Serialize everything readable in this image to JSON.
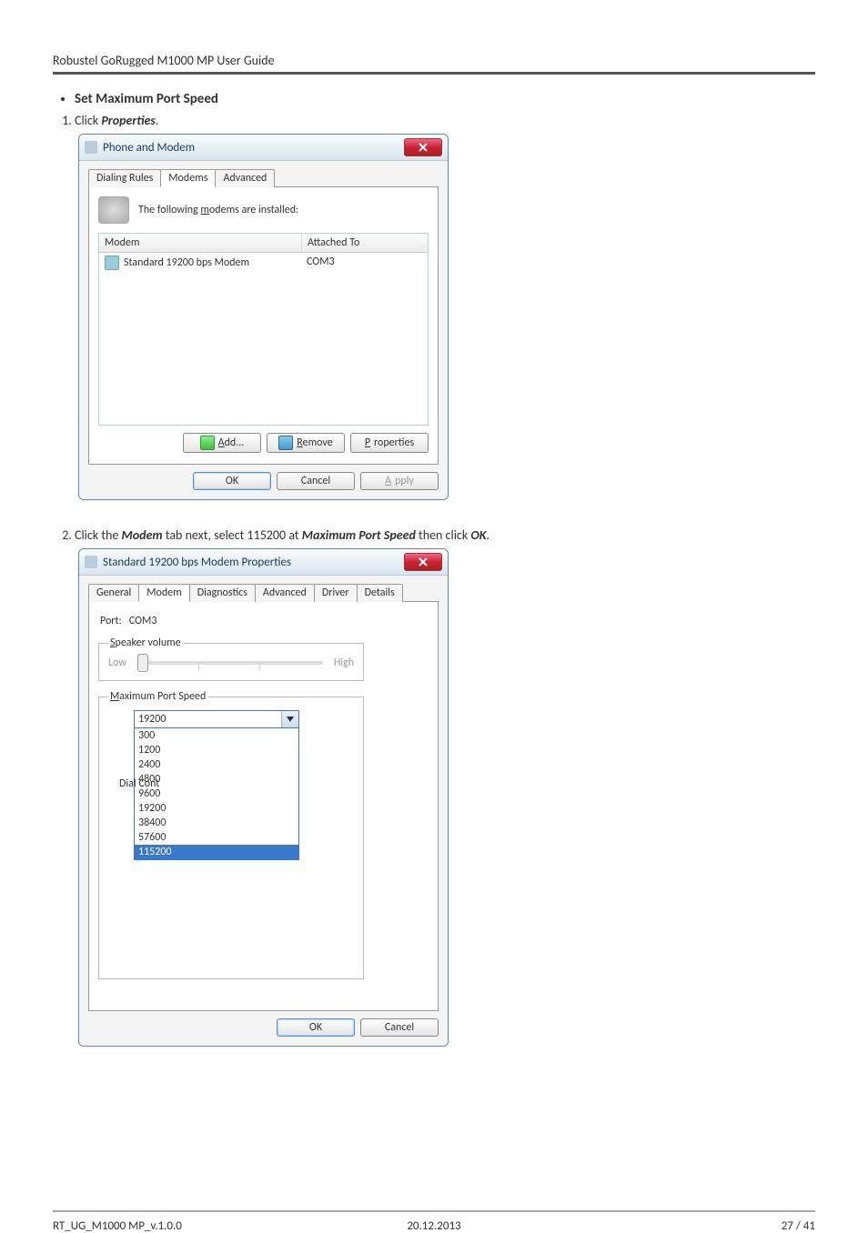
{
  "doc_header": "Robustel GoRugged M1000 MP User Guide",
  "bullet": {
    "heading": "Set Maximum Port Speed"
  },
  "step1": {
    "pre": "Click ",
    "em": "Properties",
    "post": "."
  },
  "step2": {
    "pre": "Click the ",
    "em1": "Modem",
    "mid1": " tab next, select 115200 at ",
    "em2": "Maximum Port Speed",
    "mid2": " then click ",
    "em3": "OK",
    "post": "."
  },
  "dlg1": {
    "title": "Phone and Modem",
    "tabs": [
      "Dialing Rules",
      "Modems",
      "Advanced"
    ],
    "active_tab_index": 1,
    "intro": "The following modems are installed:",
    "columns": [
      "Modem",
      "Attached To"
    ],
    "rows": [
      {
        "name": "Standard 19200 bps Modem",
        "port": "COM3"
      }
    ],
    "btn_add": "Add...",
    "btn_remove": "Remove",
    "btn_properties": "Properties",
    "btn_ok": "OK",
    "btn_cancel": "Cancel",
    "btn_apply": "Apply"
  },
  "dlg2": {
    "title": "Standard 19200 bps Modem Properties",
    "tabs": [
      "General",
      "Modem",
      "Diagnostics",
      "Advanced",
      "Driver",
      "Details"
    ],
    "active_tab_index": 1,
    "port_label": "Port:",
    "port_value": "COM3",
    "speaker_legend": "Speaker volume",
    "speaker_low": "Low",
    "speaker_high": "High",
    "speed_legend": "Maximum Port Speed",
    "combo_value": "19200",
    "combo_options": [
      "300",
      "1200",
      "2400",
      "4800",
      "9600",
      "19200",
      "38400",
      "57600",
      "115200"
    ],
    "combo_highlight_index": 8,
    "dial_cont": "Dial Cont",
    "btn_ok": "OK",
    "btn_cancel": "Cancel"
  },
  "footer": {
    "left": "RT_UG_M1000 MP_v.1.0.0",
    "center": "20.12.2013",
    "right": "27 / 41"
  }
}
